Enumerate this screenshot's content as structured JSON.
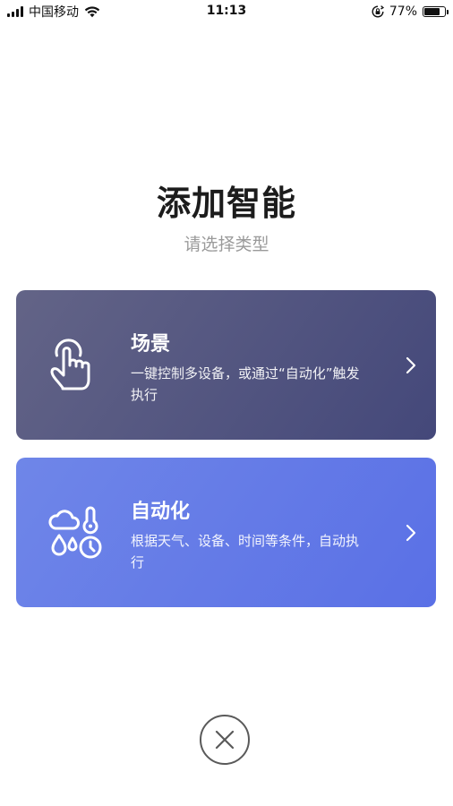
{
  "status_bar": {
    "carrier": "中国移动",
    "time": "11:13",
    "battery_percent": "77%",
    "battery_level": 0.77,
    "signal_icon": "signal-bars-icon",
    "wifi_icon": "wifi-icon",
    "orientation_lock_icon": "orientation-lock-icon"
  },
  "header": {
    "title": "添加智能",
    "subtitle": "请选择类型"
  },
  "options": [
    {
      "title": "场景",
      "description": "一键控制多设备，或通过“自动化”触发执行",
      "icon": "tap-hand-icon",
      "color_start": "#636487",
      "color_end": "#44487a"
    },
    {
      "title": "自动化",
      "description": "根据天气、设备、时间等条件，自动执行",
      "icon": "weather-conditions-icon",
      "color_start": "#6f86e8",
      "color_end": "#5a70e6"
    }
  ],
  "close_icon": "close-icon"
}
